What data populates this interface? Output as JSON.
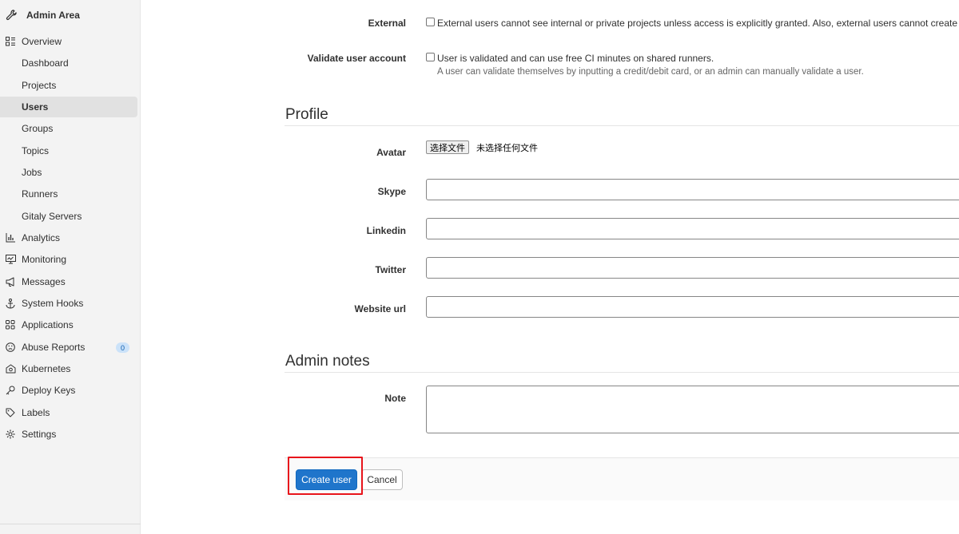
{
  "sidebar": {
    "title": "Admin Area",
    "overview_label": "Overview",
    "sub_items": [
      "Dashboard",
      "Projects",
      "Users",
      "Groups",
      "Topics",
      "Jobs",
      "Runners",
      "Gitaly Servers"
    ],
    "items": [
      "Analytics",
      "Monitoring",
      "Messages",
      "System Hooks",
      "Applications",
      "Abuse Reports",
      "Kubernetes",
      "Deploy Keys",
      "Labels",
      "Settings"
    ],
    "abuse_badge": "0",
    "active_item": "Users"
  },
  "access": {
    "external_label": "External",
    "external_text": "External users cannot see internal or private projects unless access is explicitly granted. Also, external users cannot create projects,",
    "validate_label": "Validate user account",
    "validate_text": "User is validated and can use free CI minutes on shared runners.",
    "validate_help": "A user can validate themselves by inputting a credit/debit card, or an admin can manually validate a user."
  },
  "profile": {
    "title": "Profile",
    "avatar_label": "Avatar",
    "file_button": "选择文件",
    "file_status": "未选择任何文件",
    "skype_label": "Skype",
    "linkedin_label": "Linkedin",
    "twitter_label": "Twitter",
    "website_label": "Website url"
  },
  "admin_notes": {
    "title": "Admin notes",
    "note_label": "Note"
  },
  "actions": {
    "create_label": "Create user",
    "cancel_label": "Cancel"
  }
}
